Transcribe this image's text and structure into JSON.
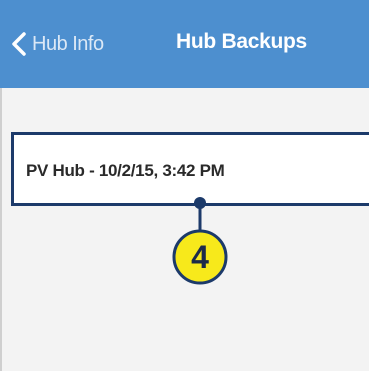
{
  "nav_bar": {
    "back_label": "Hub Info",
    "title": "Hub Backups",
    "background_color": "#4d8fcf"
  },
  "backups": {
    "items": [
      {
        "label": "PV Hub - 10/2/15, 3:42 PM"
      }
    ],
    "selected_border_color": "#1c3a6a"
  },
  "callout": {
    "number": "4",
    "fill_color": "#f7e91b",
    "stroke_color": "#1c3a6a"
  },
  "icons": {
    "back": "chevron-left-icon"
  }
}
